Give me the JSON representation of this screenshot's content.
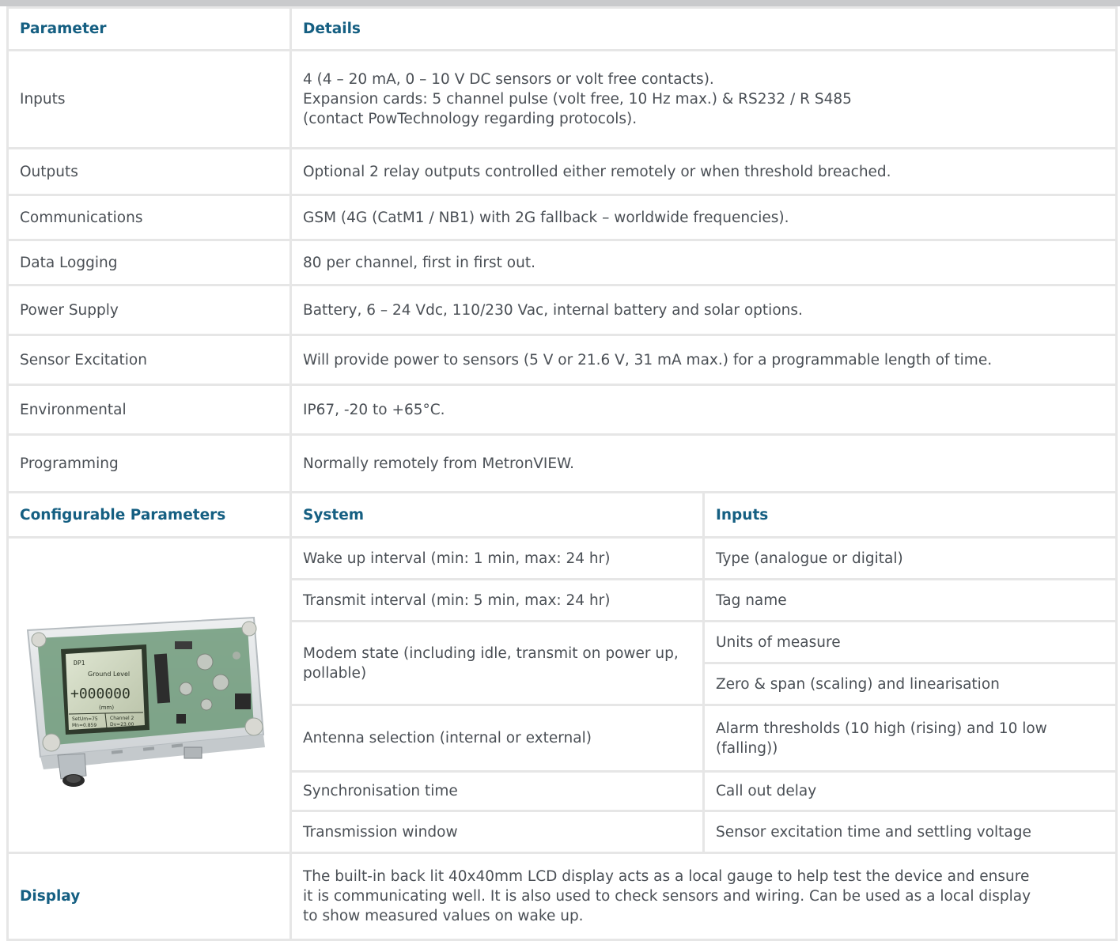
{
  "colors": {
    "heading": "#155f82",
    "text": "#4a4f55",
    "border": "#e6e6e6",
    "top_rule": "#c9cacc"
  },
  "spec_header": {
    "parameter": "Parameter",
    "details": "Details"
  },
  "spec_rows": [
    {
      "parameter": "Inputs",
      "details": [
        "4 (4 – 20 mA, 0 – 10 V DC sensors or volt free contacts).",
        "Expansion cards: 5 channel pulse (volt free, 10 Hz max.) & RS232 / R S485",
        "(contact PowTechnology regarding protocols)."
      ]
    },
    {
      "parameter": "Outputs",
      "details": [
        "Optional 2 relay outputs controlled either remotely or when threshold breached."
      ]
    },
    {
      "parameter": "Communications",
      "details": [
        "GSM (4G (CatM1 / NB1) with 2G fallback – worldwide frequencies)."
      ]
    },
    {
      "parameter": "Data Logging",
      "details": [
        "80 per channel, first in first out."
      ]
    },
    {
      "parameter": "Power Supply",
      "details": [
        "Battery, 6 – 24 Vdc, 110/230 Vac, internal battery and solar options."
      ]
    },
    {
      "parameter": "Sensor Excitation",
      "details": [
        "Will provide power to sensors (5 V or 21.6 V, 31 mA max.) for a programmable length of time."
      ]
    },
    {
      "parameter": "Environmental",
      "details": [
        "IP67, -20 to +65°C."
      ]
    },
    {
      "parameter": "Programming",
      "details": [
        "Normally remotely from MetronVIEW."
      ]
    }
  ],
  "config_header": {
    "title": "Configurable Parameters",
    "system": "System",
    "inputs": "Inputs"
  },
  "system_items": [
    "Wake up interval (min: 1 min, max: 24 hr)",
    "Transmit interval (min: 5 min, max: 24 hr)",
    "Modem state (including idle, transmit on power up, pollable)",
    "Antenna selection (internal or external)",
    "Synchronisation time",
    "Transmission window"
  ],
  "input_items": [
    "Type (analogue or digital)",
    "Tag name",
    "Units of measure",
    "Zero & span (scaling) and linearisation",
    "Alarm thresholds (10 high (rising) and 10 low (falling))",
    "Call out delay",
    "Sensor excitation time and settling voltage"
  ],
  "device_screen": {
    "line_top": "DP1",
    "line_label": "Ground Level",
    "line_value": "+000000",
    "line_unit": "(mm)",
    "cell_1": "SetUm=75",
    "cell_2": "Channel 2",
    "cell_3": "Mn=0.859",
    "cell_4": "Dv=23.00"
  },
  "display_row": {
    "label": "Display",
    "text": [
      "The built-in back lit 40x40mm LCD display acts as a local gauge to help test the device and ensure",
      "it is communicating well. It is also used to check sensors and wiring. Can be used as a local display",
      "to show measured values on wake up."
    ]
  }
}
